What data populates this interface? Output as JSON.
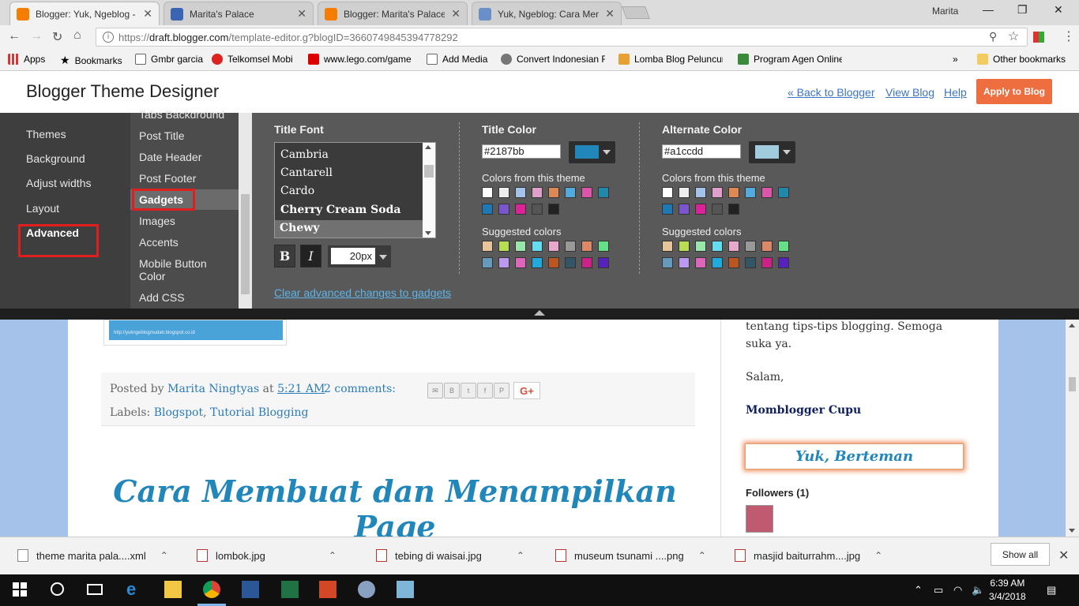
{
  "browser": {
    "tabs": [
      {
        "title": "Blogger: Yuk, Ngeblog -",
        "icon": "blogger-icon",
        "color": "#f57d00",
        "active": true
      },
      {
        "title": "Marita's Palace",
        "icon": "m-icon",
        "color": "#3c62b2",
        "active": false
      },
      {
        "title": "Blogger: Marita's Palace",
        "icon": "blogger-icon",
        "color": "#f57d00",
        "active": false
      },
      {
        "title": "Yuk, Ngeblog: Cara Mem",
        "icon": "page-icon",
        "color": "#6a8fc8",
        "active": false
      }
    ],
    "user": "Marita",
    "url_prefix": "https://",
    "url_host": "draft.blogger.com",
    "url_path": "/template-editor.g?blogID=3660749845394778292",
    "bookmarks": [
      {
        "label": "Apps",
        "icon": "apps-icon"
      },
      {
        "label": "Bookmarks",
        "icon": "star-icon"
      },
      {
        "label": "Gmbr garcia",
        "icon": "page-icon"
      },
      {
        "label": "Telkomsel Mobi",
        "icon": "telkomsel-icon"
      },
      {
        "label": "www.lego.com/game",
        "icon": "lego-icon"
      },
      {
        "label": "Add Media",
        "icon": "page-icon"
      },
      {
        "label": "Convert Indonesian R",
        "icon": "convert-icon"
      },
      {
        "label": "Lomba Blog Peluncur",
        "icon": "lomba-icon"
      },
      {
        "label": "Program Agen Online",
        "icon": "agen-icon"
      }
    ],
    "other_bookmarks": "Other bookmarks",
    "more_bookmarks": "»"
  },
  "designer": {
    "title": "Blogger Theme Designer",
    "back_link": "« Back to Blogger",
    "view_link": "View Blog",
    "help_link": "Help",
    "apply_button": "Apply to Blog",
    "left_nav": [
      "Themes",
      "Background",
      "Adjust widths",
      "Layout",
      "Advanced"
    ],
    "sub_nav": [
      "Tabs Background",
      "Post Title",
      "Date Header",
      "Post Footer",
      "Gadgets",
      "Images",
      "Accents",
      "Mobile Button",
      "Color",
      "Add CSS"
    ],
    "title_font_label": "Title Font",
    "fonts": [
      "Cambria",
      "Cantarell",
      "Cardo",
      "Cherry Cream Soda",
      "Chewy"
    ],
    "selected_font": "Chewy",
    "bold_label": "B",
    "italic_label": "I",
    "font_size": "20px",
    "title_color_label": "Title Color",
    "title_color_value": "#2187bb",
    "alternate_color_label": "Alternate Color",
    "alternate_color_value": "#a1ccdd",
    "colors_from_theme_label": "Colors from this theme",
    "suggested_colors_label": "Suggested colors",
    "theme_colors": [
      "#ffffff",
      "#eeeeee",
      "#a4c2ea",
      "#e0a0cc",
      "#dd8855",
      "#55aadd",
      "#dd55aa",
      "#2288aa",
      "#1e78b4",
      "#7a55cc",
      "#dd2299",
      "#555555",
      "#222222"
    ],
    "suggested_colors": [
      "#e8c49a",
      "#b8dd55",
      "#99e6aa",
      "#66ddee",
      "#e8a8cc",
      "#999999",
      "#dd8866",
      "#66dd88",
      "#6699bb",
      "#bb99ee",
      "#dd66bb",
      "#22aadd",
      "#bb5522",
      "#335566",
      "#cc2288",
      "#5522bb"
    ],
    "clear_link": "Clear advanced changes to gadgets"
  },
  "preview": {
    "image_caption": "http://yukngeblogmudah.blogspot.co.id",
    "posted_by": "Posted by",
    "author": "Marita Ningtyas",
    "at": "at",
    "time": "5:21 AM",
    "comments": "2 comments:",
    "labels_label": "Labels:",
    "label1": "Blogspot",
    "label_sep": ",",
    "label2": "Tutorial Blogging",
    "share_icons": [
      "email-icon",
      "blogthis-icon",
      "twitter-icon",
      "facebook-icon",
      "pinterest-icon"
    ],
    "gplus": "G+",
    "post_title": "Cara Membuat dan Menampilkan Page",
    "side_text1": "tentang tips-tips blogging. Semoga",
    "side_text2": "suka ya.",
    "salam": "Salam,",
    "signature": "Momblogger Cupu",
    "befriend": "Yuk, Berteman",
    "followers": "Followers (1)"
  },
  "downloads": [
    {
      "name": "theme marita pala....xml",
      "icon": "xml-file-icon"
    },
    {
      "name": "lombok.jpg",
      "icon": "image-file-icon"
    },
    {
      "name": "tebing di waisai.jpg",
      "icon": "image-file-icon"
    },
    {
      "name": "museum tsunami ....png",
      "icon": "image-file-icon"
    },
    {
      "name": "masjid baiturrahm....jpg",
      "icon": "image-file-icon"
    }
  ],
  "show_all": "Show all",
  "taskbar": {
    "time": "6:39 AM",
    "date": "3/4/2018"
  }
}
